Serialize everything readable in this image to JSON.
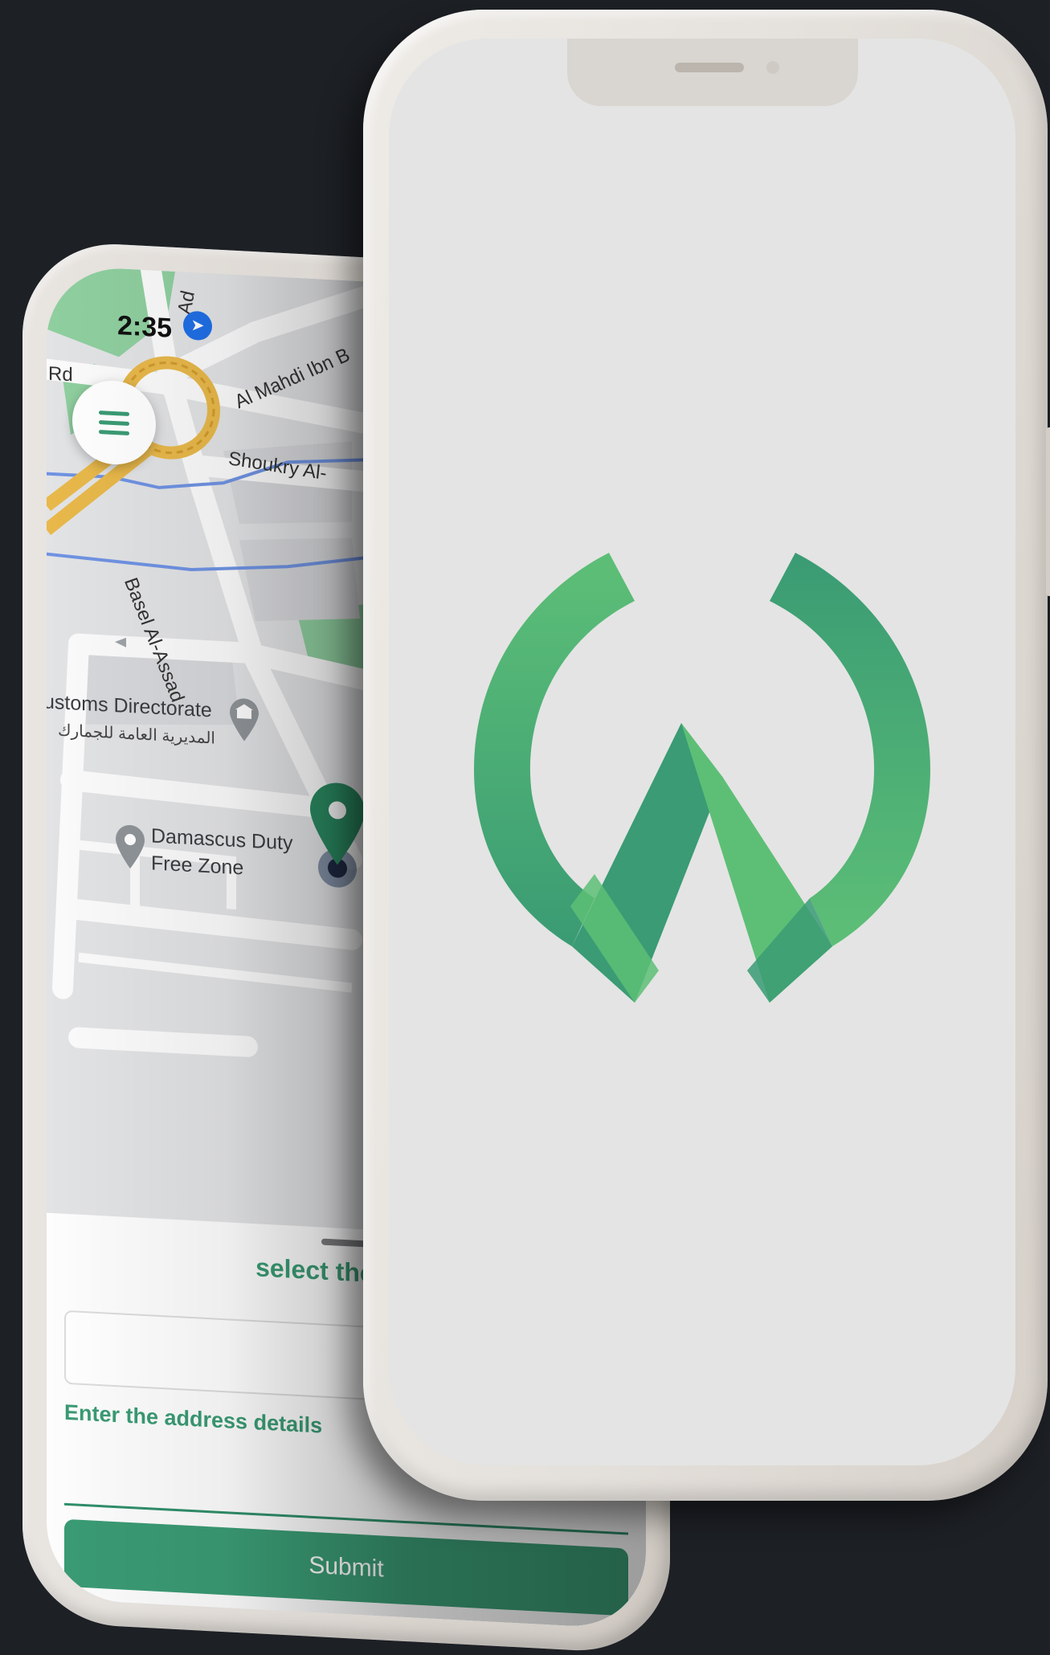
{
  "back_phone": {
    "status_bar": {
      "time": "2:35",
      "location_icon": "location-arrow-icon"
    },
    "map": {
      "labels": {
        "road_top": "Al Mahdi Ibn B",
        "road_partial": "Ad",
        "road_left": "Rd",
        "road_mid": "Shoukry Al-",
        "road_vertical": "Basel Al-Assad",
        "poi_1_en": "ustoms Directorate",
        "poi_1_ar": "المديرية العامة للجمارك",
        "poi_2_line1": "Damascus Duty",
        "poi_2_line2": "Free Zone"
      }
    },
    "sheet": {
      "title": "select the start",
      "address_value": "",
      "details_label": "Enter the address details",
      "submit_label": "Submit"
    }
  },
  "front_phone": {
    "screen": "splash",
    "logo_icon": "app-w-logo-icon",
    "colors": {
      "logo_light": "#5dbf76",
      "logo_dark": "#3a9b74",
      "screen_bg": "#e4e4e4"
    }
  }
}
